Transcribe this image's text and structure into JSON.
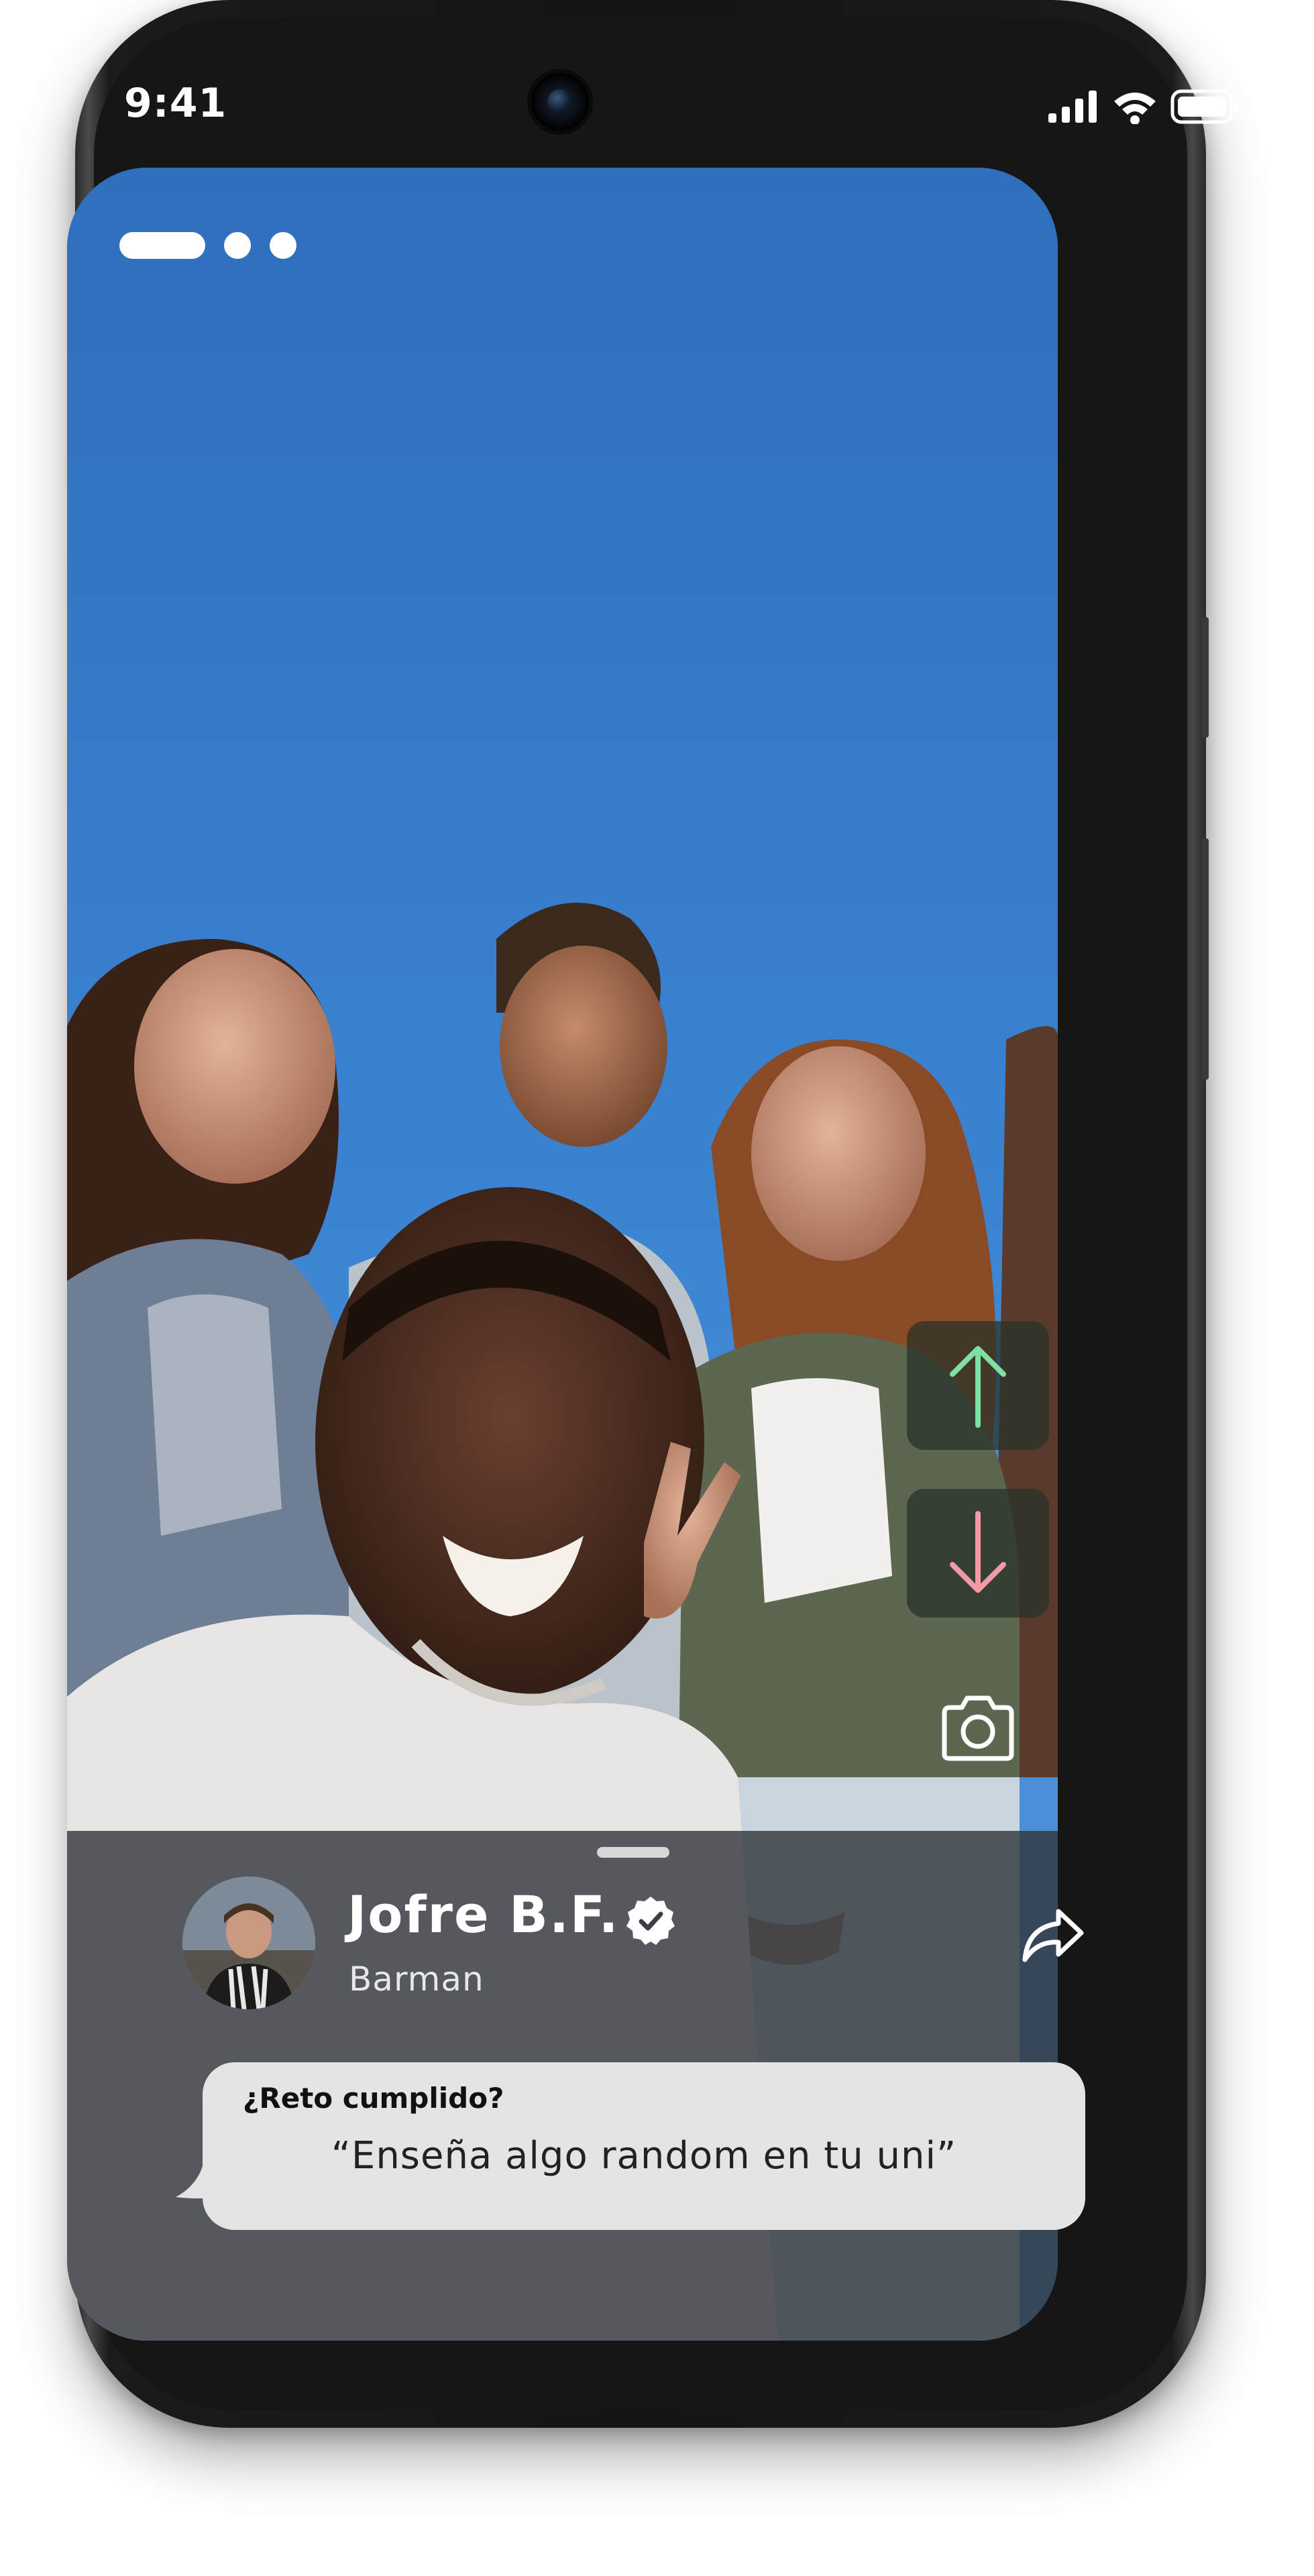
{
  "status_bar": {
    "time": "9:41"
  },
  "story": {
    "progress": {
      "current_segment": 1,
      "total_segments": 3
    }
  },
  "actions": {
    "upvote_icon": "arrow-up-icon",
    "downvote_icon": "arrow-down-icon",
    "camera_icon": "camera-icon",
    "upvote_color": "#7fe0a4",
    "downvote_color": "#f29aa6"
  },
  "profile": {
    "name": "Jofre B.F.",
    "role": "Barman",
    "verified": true,
    "share_icon": "share-icon"
  },
  "challenge": {
    "title": "¿Reto cumplido?",
    "quote": "“Enseña algo random en tu uni”"
  },
  "colors": {
    "sky_top": "#2f6fbd",
    "sky_bottom": "#4a8fd8",
    "card_overlay": "#30343a",
    "bubble_bg": "#e4e4e4"
  }
}
